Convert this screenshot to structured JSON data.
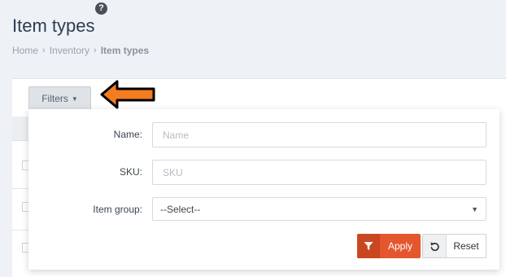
{
  "header": {
    "help_symbol": "?",
    "title": "Item types"
  },
  "breadcrumb": {
    "items": [
      "Home",
      "Inventory",
      "Item types"
    ]
  },
  "toolbar": {
    "filters_label": "Filters"
  },
  "filters": {
    "name_label": "Name:",
    "name_placeholder": "Name",
    "sku_label": "SKU:",
    "sku_placeholder": "SKU",
    "item_group_label": "Item group:",
    "item_group_value": "--Select--",
    "apply_label": "Apply",
    "reset_label": "Reset"
  },
  "colors": {
    "accent": "#e4572e",
    "annotation_arrow": "#f47c20"
  },
  "icons": {
    "help": "question-circle-icon",
    "filter_caret": "caret-down-icon",
    "apply": "funnel-icon",
    "reset": "undo-icon",
    "select": "triangle-down-icon",
    "annotation": "arrow-left-icon"
  }
}
